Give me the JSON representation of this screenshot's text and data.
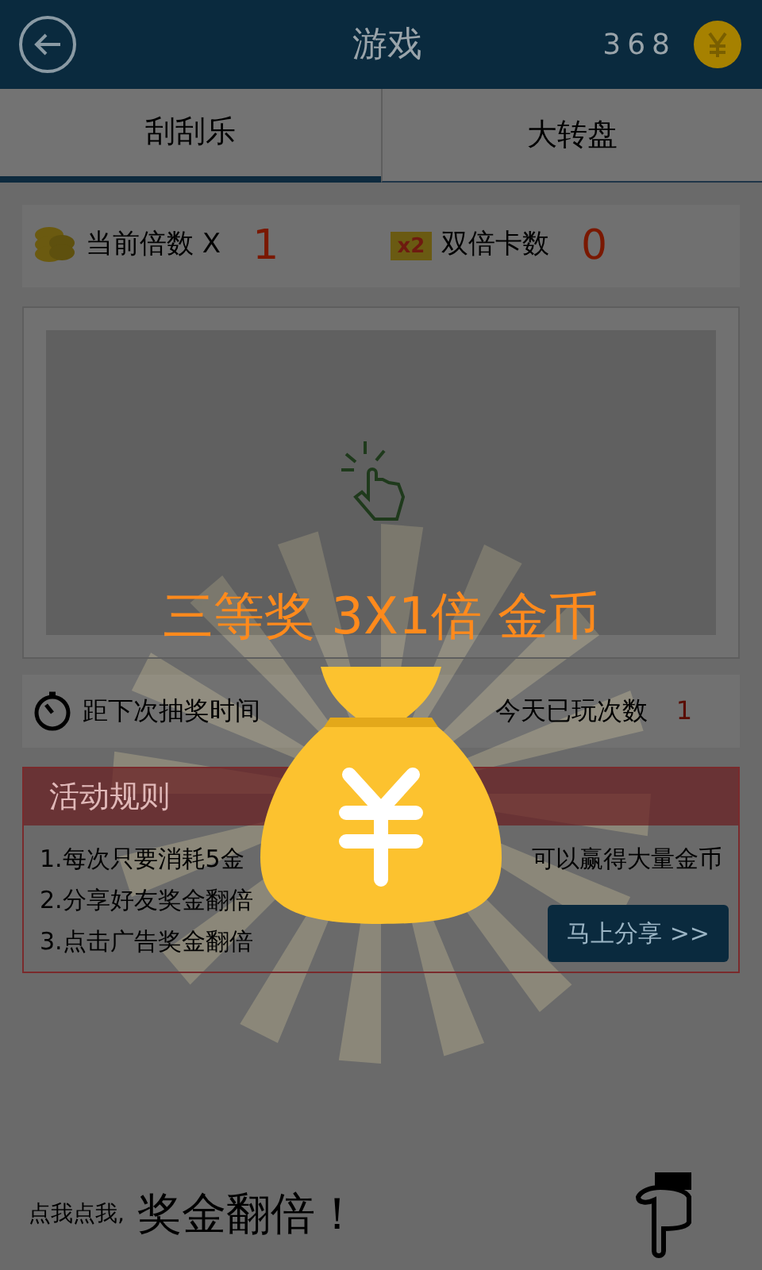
{
  "header": {
    "title": "游戏",
    "coins": "368"
  },
  "tabs": [
    {
      "label": "刮刮乐",
      "selected": true
    },
    {
      "label": "大转盘",
      "selected": false
    }
  ],
  "stats": [
    {
      "kind": "coins",
      "label": "当前倍数 X",
      "value": "1"
    },
    {
      "kind": "card",
      "icon_text": "x2",
      "label": "双倍卡数",
      "value": "0"
    }
  ],
  "play": {
    "timer_label": "距下次抽奖时间",
    "played_label": "今天已玩次数",
    "played_value": "1"
  },
  "rules": {
    "title": "活动规则",
    "lines": [
      {
        "parts": [
          "1.每次只要消耗5金",
          "可以赢得大量金币"
        ]
      },
      {
        "parts": [
          "2.分享好友奖金翻倍"
        ]
      },
      {
        "parts": [
          "3.点击广告奖金翻倍"
        ]
      }
    ],
    "share_button": "马上分享 >>"
  },
  "prize": {
    "text": "三等奖 3X1倍 金币"
  },
  "bottom": {
    "small": "点我点我,",
    "big": "奖金翻倍！"
  }
}
